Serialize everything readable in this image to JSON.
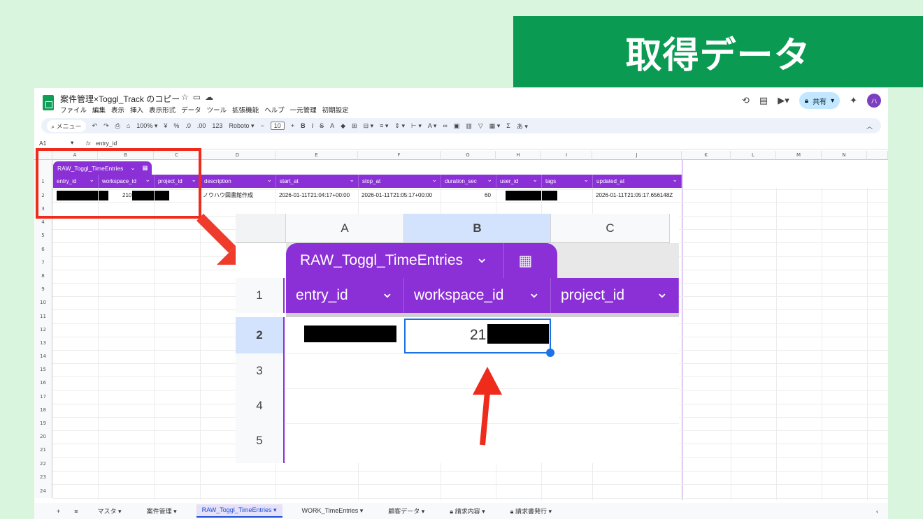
{
  "banner": {
    "title": "取得データ"
  },
  "doc": {
    "title": "案件管理×Toggl_Track のコピー",
    "menu": [
      "ファイル",
      "編集",
      "表示",
      "挿入",
      "表示形式",
      "データ",
      "ツール",
      "拡張機能",
      "ヘルプ",
      "一元管理",
      "初期設定"
    ],
    "share_label": "共有",
    "avatar_initial": "ハ"
  },
  "toolbar": {
    "menu_search": "メニュー",
    "zoom": "100%",
    "currency": "¥",
    "percent": "%",
    "dec_minus": ".0",
    "dec_plus": ".00",
    "number_format": "123",
    "font": "Roboto",
    "font_size": "10",
    "bold": "B",
    "italic": "I",
    "strike": "S",
    "textcolor": "A",
    "sigma": "Σ",
    "input_mode": "あ"
  },
  "formula_bar": {
    "cell_ref": "A1",
    "fx": "fx",
    "value": "entry_id"
  },
  "columns": [
    "A",
    "B",
    "C",
    "D",
    "E",
    "F",
    "G",
    "H",
    "I",
    "J",
    "K",
    "L",
    "M",
    "N"
  ],
  "rows": [
    "1",
    "2",
    "3",
    "4",
    "5",
    "6",
    "7",
    "8",
    "9",
    "10",
    "11",
    "12",
    "13",
    "14",
    "15",
    "16",
    "17",
    "18",
    "19",
    "20",
    "21",
    "22",
    "23",
    "24"
  ],
  "table": {
    "name": "RAW_Toggl_TimeEntries",
    "headers": [
      "entry_id",
      "workspace_id",
      "project_id",
      "description",
      "start_at",
      "stop_at",
      "duration_sec",
      "user_id",
      "tags",
      "updated_at"
    ],
    "row2": {
      "workspace_id": "210",
      "description": "ノウハウ図書館作成",
      "start_at": "2026-01-11T21:04:17+00:00",
      "stop_at": "2026-01-11T21:05:17+00:00",
      "duration_sec": "60",
      "updated_at": "2026-01-11T21:05:17.656148Z"
    }
  },
  "zoom": {
    "columns": [
      "A",
      "B",
      "C"
    ],
    "rows": [
      "1",
      "2",
      "3",
      "4",
      "5"
    ],
    "table_name": "RAW_Toggl_TimeEntries",
    "headers": [
      "entry_id",
      "workspace_id",
      "project_id"
    ],
    "workspace_value": "21"
  },
  "sheet_tabs": [
    "マスタ",
    "案件管理",
    "RAW_Toggl_TimeEntries",
    "WORK_TimeEntries",
    "顧客データ",
    "請求内容",
    "請求書発行"
  ],
  "colors": {
    "accent": "#8b2fd6",
    "banner": "#0a9a52",
    "highlight": "#ef2b1b",
    "selection": "#1a73e8"
  }
}
